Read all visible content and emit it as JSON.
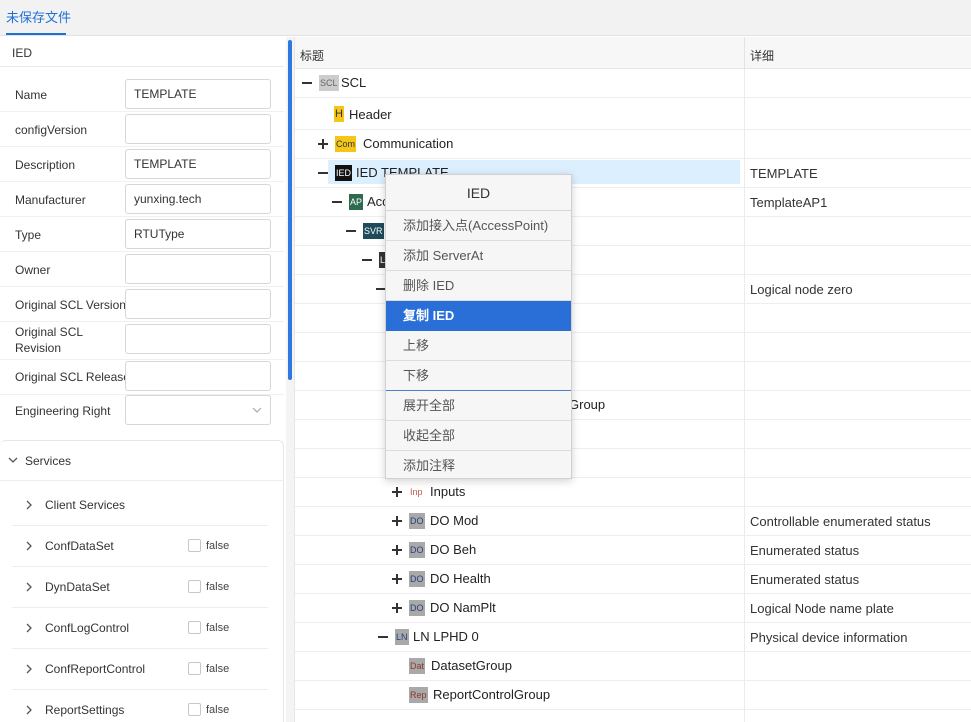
{
  "tabs": {
    "active_label": "未保存文件"
  },
  "left_panel": {
    "title": "IED",
    "properties": [
      {
        "label": "Name",
        "value": "TEMPLATE"
      },
      {
        "label": "configVersion",
        "value": ""
      },
      {
        "label": "Description",
        "value": "TEMPLATE"
      },
      {
        "label": "Manufacturer",
        "value": "yunxing.tech"
      },
      {
        "label": "Type",
        "value": "RTUType"
      },
      {
        "label": "Owner",
        "value": ""
      },
      {
        "label": "Original SCL Version",
        "value": ""
      },
      {
        "label": "Original SCL Revision",
        "value": ""
      },
      {
        "label": "Original SCL Release",
        "value": ""
      },
      {
        "label": "Engineering Right",
        "value": ""
      }
    ],
    "services": {
      "title": "Services",
      "items": [
        {
          "label": "Client Services",
          "value": ""
        },
        {
          "label": "ConfDataSet",
          "value": "false"
        },
        {
          "label": "DynDataSet",
          "value": "false"
        },
        {
          "label": "ConfLogControl",
          "value": "false"
        },
        {
          "label": "ConfReportControl",
          "value": "false"
        },
        {
          "label": "ReportSettings",
          "value": "false"
        }
      ]
    }
  },
  "tree": {
    "columns": {
      "title": "标题",
      "detail": "详细"
    },
    "rows": [
      {
        "badge": "SCL",
        "text": "SCL",
        "detail": ""
      },
      {
        "badge": "H",
        "text": "Header",
        "detail": ""
      },
      {
        "badge": "Com",
        "text": "Communication",
        "detail": ""
      },
      {
        "badge": "IED",
        "text": "IED TEMPLATE",
        "detail": "TEMPLATE"
      },
      {
        "badge": "AP",
        "text": "Acc",
        "detail": "TemplateAP1"
      },
      {
        "badge": "SVR",
        "text": "",
        "detail": ""
      },
      {
        "badge": "L",
        "text": "",
        "detail": ""
      },
      {
        "badge": "",
        "text": "",
        "detail": "Logical node zero"
      },
      {
        "badge": "",
        "text": "",
        "detail": ""
      },
      {
        "badge": "",
        "text": "",
        "detail": ""
      },
      {
        "badge": "",
        "text": "",
        "detail": ""
      },
      {
        "badge": "",
        "text": "Group",
        "detail": ""
      },
      {
        "badge": "",
        "text": "",
        "detail": ""
      },
      {
        "badge": "",
        "text": "",
        "detail": ""
      },
      {
        "badge": "Inp",
        "text": "Inputs",
        "detail": ""
      },
      {
        "badge": "DO",
        "text": "DO Mod",
        "detail": "Controllable enumerated status"
      },
      {
        "badge": "DO",
        "text": "DO Beh",
        "detail": "Enumerated status"
      },
      {
        "badge": "DO",
        "text": "DO Health",
        "detail": "Enumerated status"
      },
      {
        "badge": "DO",
        "text": "DO NamPlt",
        "detail": "Logical Node name plate"
      },
      {
        "badge": "LN",
        "text": "LN LPHD 0",
        "detail": "Physical device information"
      },
      {
        "badge": "Dat",
        "text": "DatasetGroup",
        "detail": ""
      },
      {
        "badge": "Rep",
        "text": "ReportControlGroup",
        "detail": ""
      }
    ]
  },
  "context_menu": {
    "title": "IED",
    "items": [
      "添加接入点(AccessPoint)",
      "添加 ServerAt",
      "删除 IED",
      "复制 IED",
      "上移",
      "下移",
      "展开全部",
      "收起全部",
      "添加注释"
    ]
  },
  "colors": {
    "accent": "#1f6fd6",
    "menu_highlight": "#2a6fd8",
    "selected_row": "#dcefff"
  }
}
